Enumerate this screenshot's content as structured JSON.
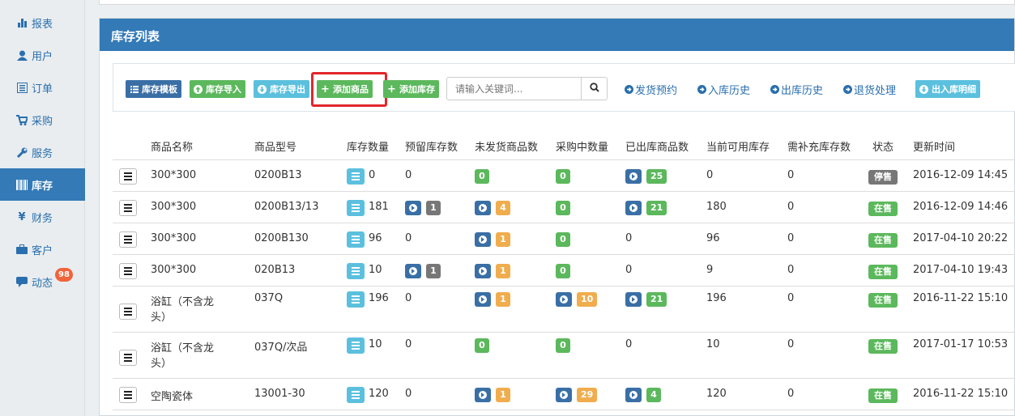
{
  "sidebar": {
    "items": [
      {
        "label": "报表",
        "icon": "bar-chart-icon"
      },
      {
        "label": "用户",
        "icon": "user-icon"
      },
      {
        "label": "订单",
        "icon": "list-alt-icon"
      },
      {
        "label": "采购",
        "icon": "shopping-cart-icon"
      },
      {
        "label": "服务",
        "icon": "wrench-icon"
      },
      {
        "label": "库存",
        "icon": "barcode-icon"
      },
      {
        "label": "财务",
        "icon": "yen-icon"
      },
      {
        "label": "客户",
        "icon": "briefcase-icon"
      },
      {
        "label": "动态",
        "icon": "comment-icon"
      }
    ],
    "active": "库存",
    "dynamic_badge": "98"
  },
  "panel": {
    "title": "库存列表"
  },
  "toolbar": {
    "btn_template": "库存模板",
    "btn_import": "库存导入",
    "btn_export": "库存导出",
    "btn_add_product": "添加商品",
    "btn_add_stock": "添加库存",
    "search_placeholder": "请输入关键词...",
    "link_ship_booking": "发货预约",
    "link_in_history": "入库历史",
    "link_out_history": "出库历史",
    "link_return": "退货处理",
    "btn_in_out_detail": "出入库明细"
  },
  "table": {
    "headers": [
      "商品名称",
      "商品型号",
      "库存数量",
      "预留库存数",
      "未发货商品数",
      "采购中数量",
      "已出库商品数",
      "当前可用库存",
      "需补充库存数",
      "状态",
      "更新时间"
    ],
    "rows": [
      {
        "name": "300*300",
        "name2": "",
        "model": "0200B13",
        "stock": "0",
        "reserved": "0",
        "reserved_lbl": "",
        "unshipped": "0",
        "unshipped_color": "green",
        "unshipped_arrow": false,
        "purchasing": "0",
        "purchasing_color": "green",
        "purchasing_arrow": false,
        "shipped": "25",
        "shipped_arrow": true,
        "available": "0",
        "replenish": "0",
        "status": "停售",
        "status_color": "gray",
        "updated": "2016-12-09 14:45"
      },
      {
        "name": "300*300",
        "name2": "",
        "model": "0200B13/13",
        "stock": "181",
        "reserved": "",
        "reserved_lbl": "1",
        "unshipped": "4",
        "unshipped_color": "orange",
        "unshipped_arrow": true,
        "purchasing": "0",
        "purchasing_color": "green",
        "purchasing_arrow": false,
        "shipped": "21",
        "shipped_arrow": true,
        "available": "180",
        "replenish": "0",
        "status": "在售",
        "status_color": "green",
        "updated": "2016-12-09 14:46"
      },
      {
        "name": "300*300",
        "name2": "",
        "model": "0200B130",
        "stock": "96",
        "reserved": "0",
        "reserved_lbl": "",
        "unshipped": "1",
        "unshipped_color": "orange",
        "unshipped_arrow": true,
        "purchasing": "0",
        "purchasing_color": "green",
        "purchasing_arrow": false,
        "shipped": "0",
        "shipped_arrow": false,
        "available": "96",
        "replenish": "0",
        "status": "在售",
        "status_color": "green",
        "updated": "2017-04-10 20:22"
      },
      {
        "name": "300*300",
        "name2": "",
        "model": "020B13",
        "stock": "10",
        "reserved": "",
        "reserved_lbl": "1",
        "unshipped": "1",
        "unshipped_color": "orange",
        "unshipped_arrow": true,
        "purchasing": "0",
        "purchasing_color": "green",
        "purchasing_arrow": false,
        "shipped": "0",
        "shipped_arrow": false,
        "available": "9",
        "replenish": "0",
        "status": "在售",
        "status_color": "green",
        "updated": "2017-04-10 19:43"
      },
      {
        "name": "浴缸（不含龙",
        "name2": "头）",
        "model": "037Q",
        "stock": "196",
        "reserved": "0",
        "reserved_lbl": "",
        "unshipped": "1",
        "unshipped_color": "orange",
        "unshipped_arrow": true,
        "purchasing": "10",
        "purchasing_color": "orange",
        "purchasing_arrow": true,
        "shipped": "21",
        "shipped_arrow": true,
        "available": "196",
        "replenish": "0",
        "status": "在售",
        "status_color": "green",
        "updated": "2016-11-22 15:10"
      },
      {
        "name": "浴缸（不含龙",
        "name2": "头）",
        "model": "037Q/次品",
        "stock": "10",
        "reserved": "0",
        "reserved_lbl": "",
        "unshipped": "0",
        "unshipped_color": "green",
        "unshipped_arrow": false,
        "purchasing": "0",
        "purchasing_color": "green",
        "purchasing_arrow": false,
        "shipped": "0",
        "shipped_arrow": false,
        "available": "10",
        "replenish": "0",
        "status": "在售",
        "status_color": "green",
        "updated": "2017-01-17 10:53"
      },
      {
        "name": "空陶瓷体",
        "name2": "",
        "model": "13001-30",
        "stock": "120",
        "reserved": "0",
        "reserved_lbl": "",
        "unshipped": "1",
        "unshipped_color": "orange",
        "unshipped_arrow": true,
        "purchasing": "29",
        "purchasing_color": "orange",
        "purchasing_arrow": true,
        "shipped": "4",
        "shipped_arrow": true,
        "available": "120",
        "replenish": "0",
        "status": "在售",
        "status_color": "green",
        "updated": "2016-11-22 15:10"
      }
    ]
  },
  "colors": {
    "primary": "#337ab7",
    "green": "#5cb85c",
    "orange": "#f0ad4e",
    "cyan": "#5bc0de",
    "gray": "#777777",
    "highlight": "#e3262b"
  }
}
